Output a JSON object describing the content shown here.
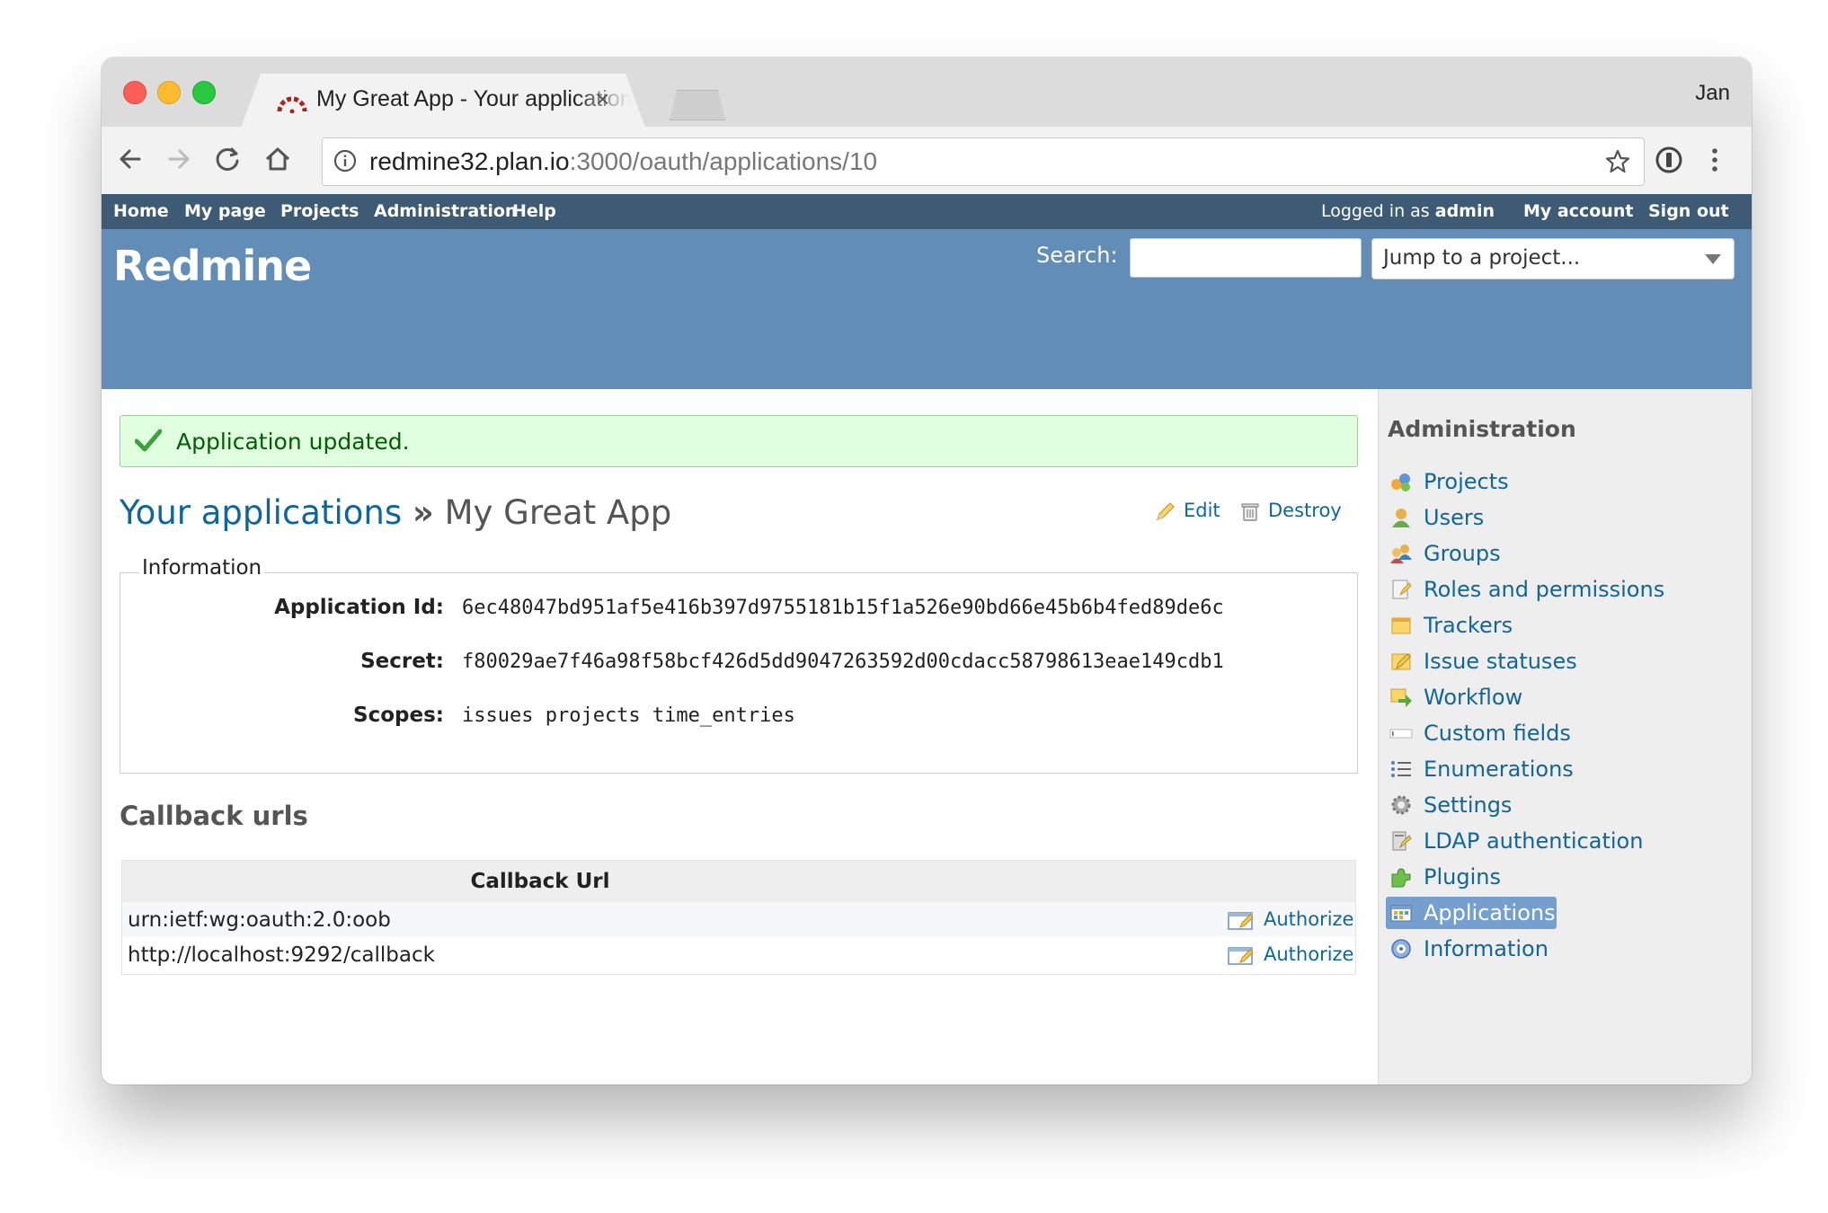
{
  "browser": {
    "tab_title": "My Great App - Your applications",
    "tab_close": "×",
    "profile_name": "Jan",
    "url_host": "redmine32.plan.io",
    "url_rest": ":3000/oauth/applications/10"
  },
  "topmenu": {
    "items": [
      "Home",
      "My page",
      "Projects",
      "Administration",
      "Help"
    ],
    "logged_in_prefix": "Logged in as",
    "logged_in_user": "admin",
    "my_account": "My account",
    "sign_out": "Sign out"
  },
  "header": {
    "title": "Redmine",
    "search_label": "Search:",
    "jump_placeholder": "Jump to a project..."
  },
  "flash": {
    "message": "Application updated."
  },
  "page": {
    "breadcrumb_link": "Your applications",
    "breadcrumb_sep": "»",
    "title": "My Great App",
    "edit_label": "Edit",
    "destroy_label": "Destroy"
  },
  "information": {
    "legend": "Information",
    "fields": [
      {
        "label": "Application Id:",
        "value": "6ec48047bd951af5e416b397d9755181b15f1a526e90bd66e45b6b4fed89de6c"
      },
      {
        "label": "Secret:",
        "value": "f80029ae7f46a98f58bcf426d5dd9047263592d00cdacc58798613eae149cdb1"
      },
      {
        "label": "Scopes:",
        "value": "issues projects time_entries"
      }
    ]
  },
  "callbacks": {
    "heading": "Callback urls",
    "column_header": "Callback Url",
    "rows": [
      {
        "url": "urn:ietf:wg:oauth:2.0:oob",
        "action": "Authorize"
      },
      {
        "url": "http://localhost:9292/callback",
        "action": "Authorize"
      }
    ]
  },
  "sidebar": {
    "title": "Administration",
    "items": [
      {
        "label": "Projects",
        "icon": "projects-icon"
      },
      {
        "label": "Users",
        "icon": "users-icon"
      },
      {
        "label": "Groups",
        "icon": "groups-icon"
      },
      {
        "label": "Roles and permissions",
        "icon": "roles-icon"
      },
      {
        "label": "Trackers",
        "icon": "trackers-icon"
      },
      {
        "label": "Issue statuses",
        "icon": "issue-statuses-icon"
      },
      {
        "label": "Workflow",
        "icon": "workflow-icon"
      },
      {
        "label": "Custom fields",
        "icon": "custom-fields-icon"
      },
      {
        "label": "Enumerations",
        "icon": "enumerations-icon"
      },
      {
        "label": "Settings",
        "icon": "settings-icon"
      },
      {
        "label": "LDAP authentication",
        "icon": "ldap-icon"
      },
      {
        "label": "Plugins",
        "icon": "plugins-icon"
      },
      {
        "label": "Applications",
        "icon": "applications-icon",
        "selected": true
      },
      {
        "label": "Information",
        "icon": "information-icon"
      }
    ]
  },
  "colors": {
    "topmenu_bg": "#3e5b76",
    "header_bg": "#628db6",
    "link": "#116699",
    "flash_bg": "#dfffdf",
    "selected_bg": "#759fcf"
  }
}
